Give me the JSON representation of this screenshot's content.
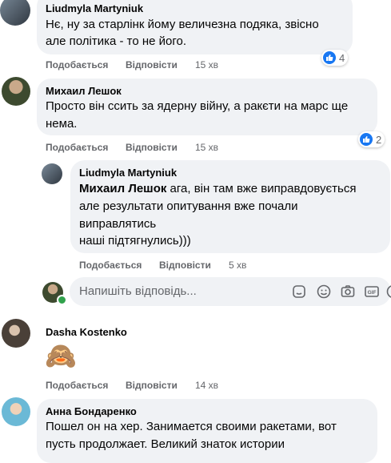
{
  "comments": [
    {
      "author": "Liudmyla Martyniuk",
      "lines": [
        "Нє, ну за старлінк йому величезна подяка, звісно",
        "але політика - то не його."
      ],
      "like_label": "Подобається",
      "reply_label": "Відповісти",
      "time": "15 хв",
      "reactions": "4"
    },
    {
      "author": "Михаил Лешок",
      "lines": [
        "Просто він ссить за ядерну війну, а ракєти на марс ще",
        "нема."
      ],
      "like_label": "Подобається",
      "reply_label": "Відповісти",
      "time": "15 хв",
      "reactions": "2"
    },
    {
      "author": "Liudmyla Martyniuk",
      "mention": "Михаил Лешок",
      "lines": [
        " ага, він там вже виправдовується",
        "але результати опитування вже почали",
        "виправлятись",
        "наші підтягнулись)))"
      ],
      "like_label": "Подобається",
      "reply_label": "Відповісти",
      "time": "5 хв"
    },
    {
      "author": "Dasha Kostenko",
      "emoji": "🙈",
      "like_label": "Подобається",
      "reply_label": "Відповісти",
      "time": "14 хв"
    },
    {
      "author": "Анна Бондаренко",
      "lines": [
        "Пошел он на хер. Занимается своими ракетами, вот",
        "пусть продолжает. Великий знаток истории"
      ]
    }
  ],
  "reply_input": {
    "placeholder": "Напишіть відповідь..."
  },
  "icons": [
    "sticker-icon",
    "emoji-icon",
    "camera-icon",
    "gif-icon",
    "sticker-smile-icon"
  ],
  "colors": {
    "bubble": "#f0f2f5",
    "meta": "#65676b",
    "like": "#1877f2",
    "online": "#31a24c"
  }
}
